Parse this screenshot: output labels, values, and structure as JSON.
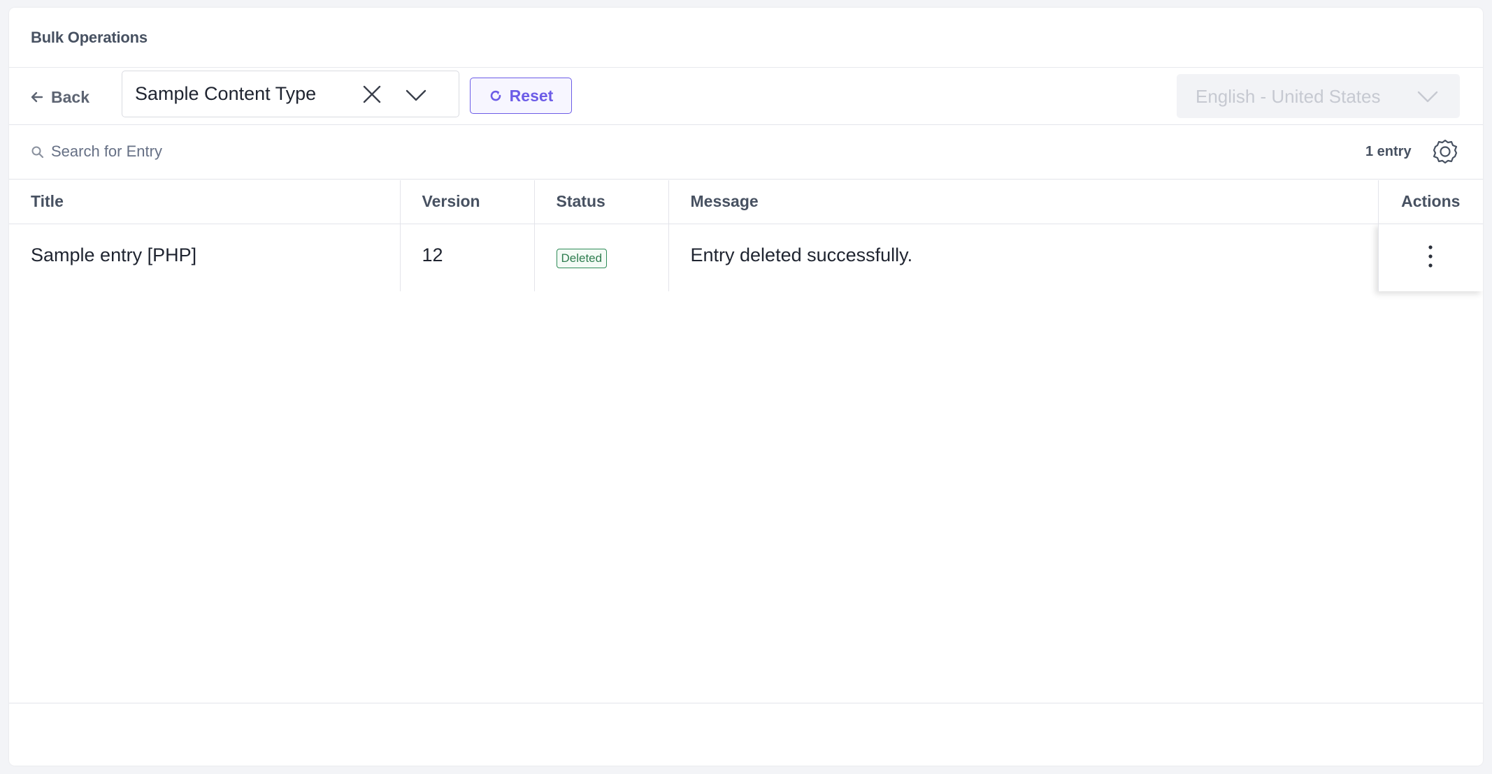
{
  "header": {
    "title": "Bulk Operations"
  },
  "toolbar": {
    "back_label": "Back",
    "content_type": {
      "value": "Sample Content Type"
    },
    "reset_label": "Reset",
    "locale": {
      "value": "English - United States",
      "disabled": true
    }
  },
  "search": {
    "placeholder": "Search for Entry",
    "value": "",
    "entry_count": "1 entry"
  },
  "table": {
    "columns": [
      "Title",
      "Version",
      "Status",
      "Message",
      "Actions"
    ],
    "rows": [
      {
        "title": "Sample entry [PHP]",
        "version": "12",
        "status": "Deleted",
        "message": "Entry deleted successfully."
      }
    ]
  },
  "colors": {
    "accent": "#6c5ce7",
    "status_deleted": "#2e8b57"
  },
  "icons": {
    "back": "arrow-left-icon",
    "clear": "close-icon",
    "dropdown": "chevron-down-icon",
    "reset": "refresh-icon",
    "search": "search-icon",
    "settings": "gear-icon",
    "row_actions": "kebab-menu-icon"
  }
}
